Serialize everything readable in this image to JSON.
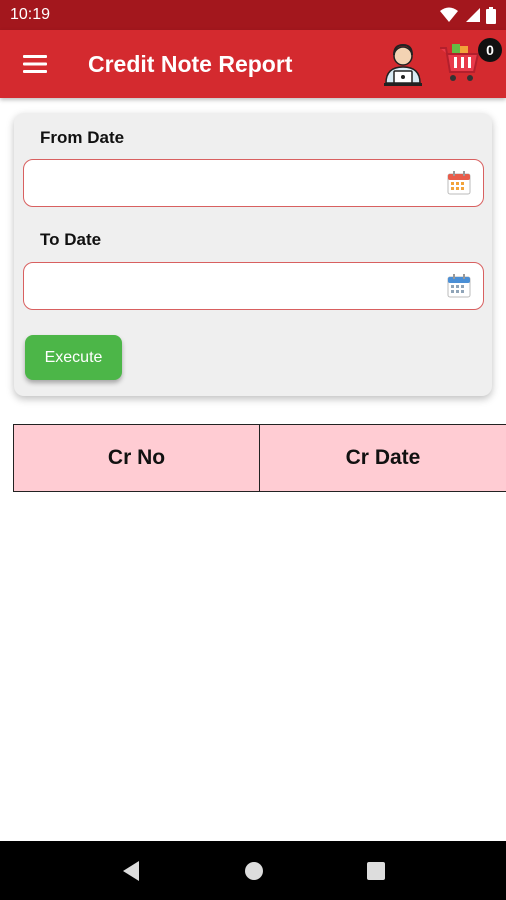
{
  "status_bar": {
    "time": "10:19"
  },
  "app_bar": {
    "title": "Credit Note Report",
    "cart_count": "0",
    "menu_icon": "hamburger-menu-icon",
    "avatar_icon": "support-agent-icon",
    "cart_icon": "shopping-cart-icon"
  },
  "form": {
    "from_date_label": "From Date",
    "from_date_value": "",
    "to_date_label": "To Date",
    "to_date_value": "",
    "execute_label": "Execute"
  },
  "table": {
    "columns": [
      "Cr No",
      "Cr Date"
    ]
  },
  "colors": {
    "app_bar": "#d42a2f",
    "status_bar": "#a3171d",
    "execute_button": "#4cb648",
    "table_header": "#ffccd3"
  }
}
